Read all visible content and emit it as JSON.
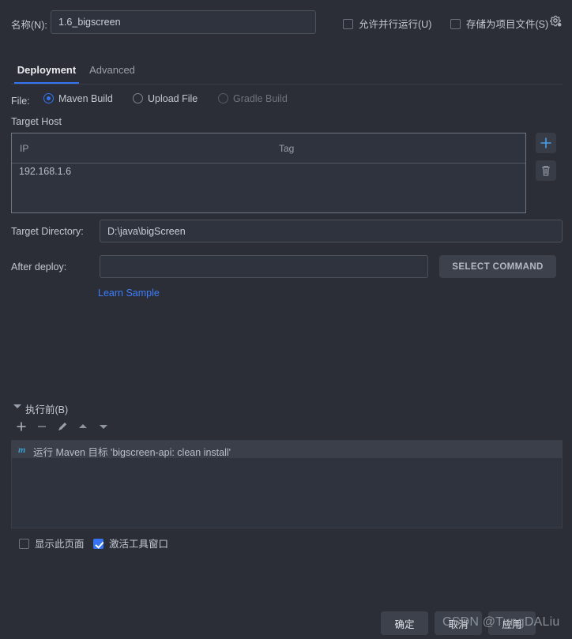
{
  "window": {
    "bg_color": "#2b2e36",
    "accent_color": "#3574f0",
    "link_color": "#3c7eff"
  },
  "name_row": {
    "label": "名称(N):",
    "value": "1.6_bigscreen",
    "placeholder": "",
    "allow_parallel_label": "允许并行运行(U)",
    "allow_parallel_checked": false,
    "store_as_project_label": "存储为项目文件(S)",
    "store_as_project_checked": false,
    "gear_icon": "gear-icon"
  },
  "tabs": [
    {
      "label": "Deployment",
      "active": true
    },
    {
      "label": "Advanced",
      "active": false
    }
  ],
  "file_row": {
    "label": "File:",
    "options": [
      {
        "label": "Maven Build",
        "selected": true,
        "disabled": false
      },
      {
        "label": "Upload File",
        "selected": false,
        "disabled": false
      },
      {
        "label": "Gradle Build",
        "selected": false,
        "disabled": true
      }
    ]
  },
  "target_host": {
    "section_label": "Target Host",
    "columns": [
      "IP",
      "Tag"
    ],
    "rows": [
      {
        "ip": "192.168.1.6",
        "tag": ""
      }
    ],
    "add_icon": "plus-icon",
    "delete_icon": "trash-icon"
  },
  "target_directory": {
    "label": "Target Directory:",
    "value": "D:\\java\\bigScreen",
    "placeholder": ""
  },
  "after_deploy": {
    "label": "After deploy:",
    "value": "",
    "placeholder": "",
    "select_command_label": "SELECT COMMAND",
    "learn_sample_label": "Learn Sample"
  },
  "before_launch": {
    "title": "执行前(B)",
    "expanded": true,
    "toolbar": [
      {
        "name": "add-icon",
        "glyph": "+"
      },
      {
        "name": "remove-icon",
        "glyph": "−"
      },
      {
        "name": "edit-pencil-icon",
        "glyph": "✎"
      },
      {
        "name": "move-up-icon",
        "glyph": "▲"
      },
      {
        "name": "move-down-icon",
        "glyph": "▼"
      }
    ],
    "items": [
      {
        "icon": "maven-icon",
        "icon_glyph": "m",
        "text": "运行 Maven 目标 'bigscreen-api: clean install'",
        "selected": true
      }
    ]
  },
  "bottom_options": {
    "show_page_label": "显示此页面",
    "show_page_checked": false,
    "activate_tool_window_label": "激活工具窗口",
    "activate_tool_window_checked": true
  },
  "dialog_buttons": {
    "ok": "确定",
    "cancel": "取消",
    "apply": "应用"
  },
  "watermark": {
    "text": "CSDN @TungDALiu"
  }
}
